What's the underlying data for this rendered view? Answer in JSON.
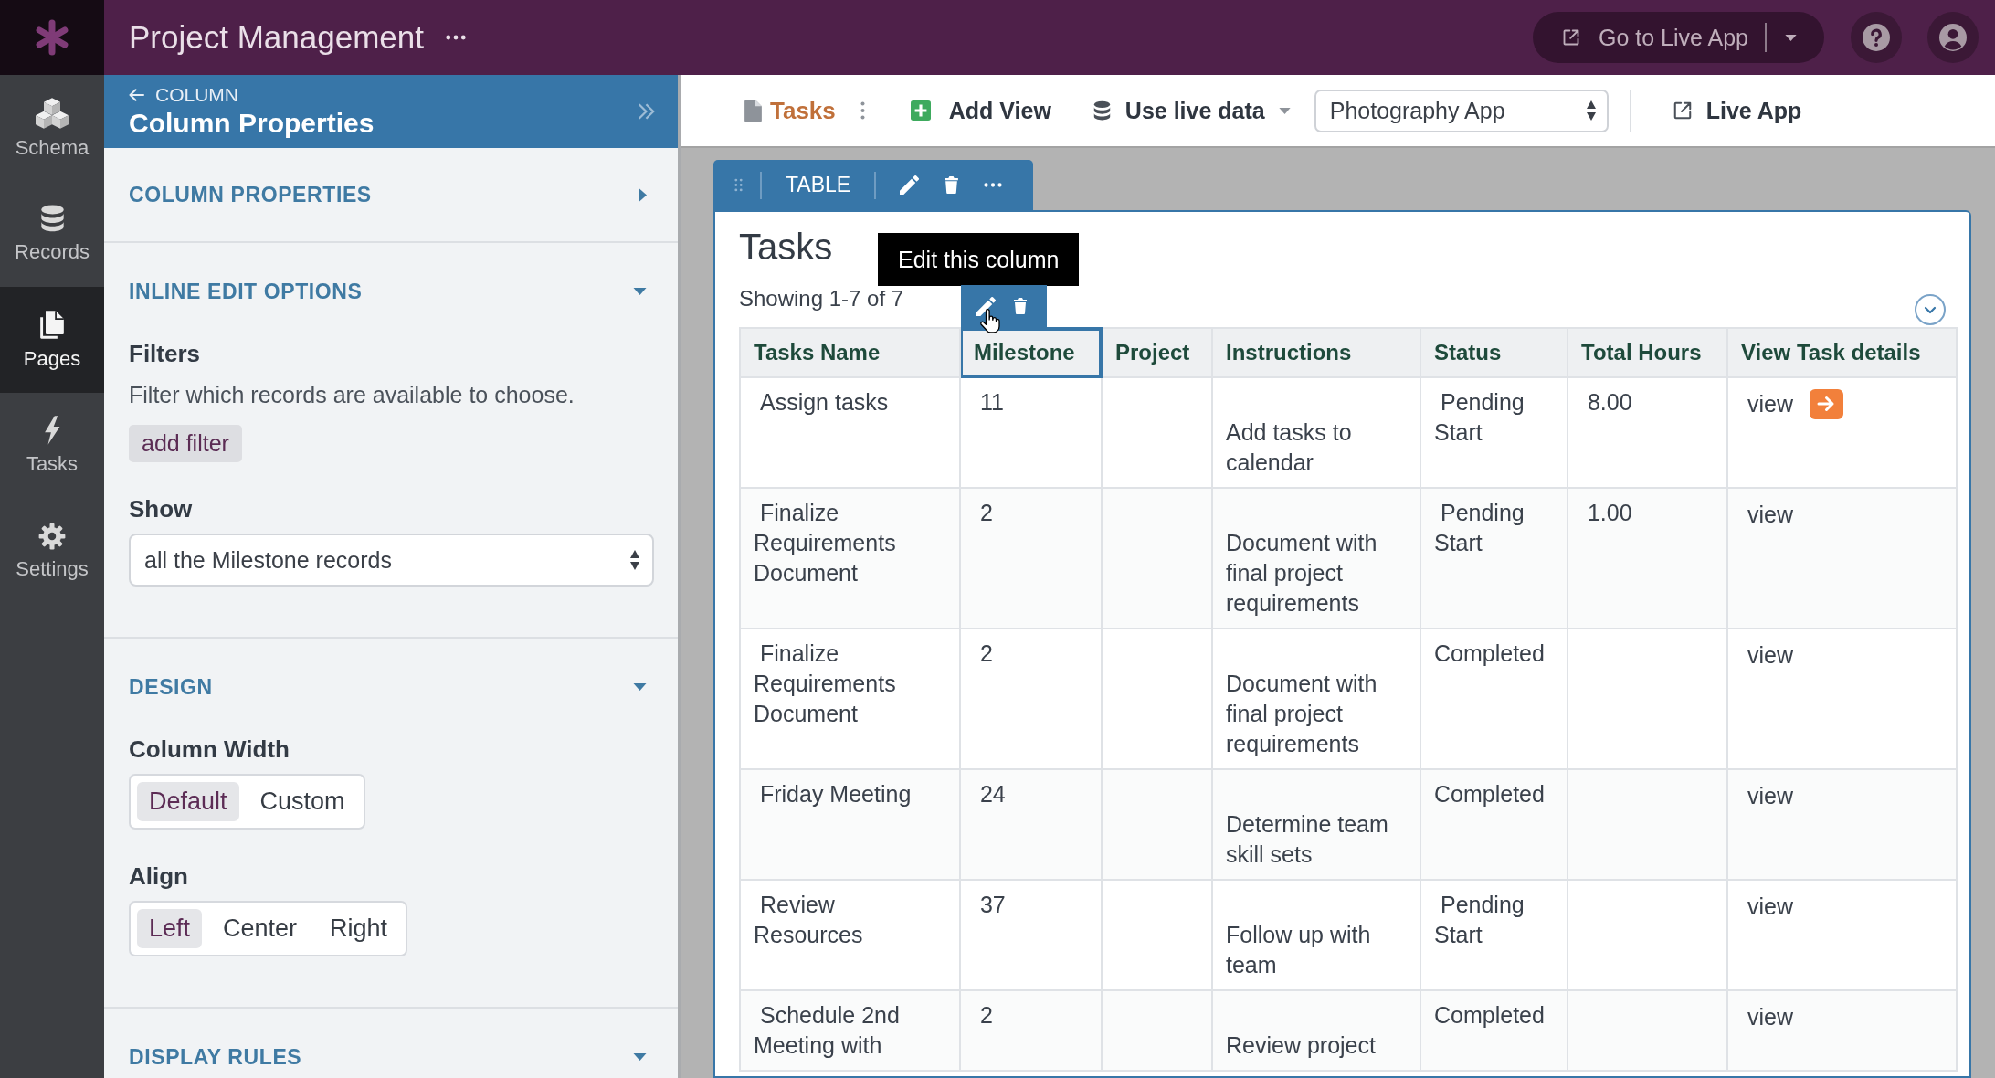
{
  "app_bar": {
    "title": "Project Management",
    "live_app_button": "Go to Live App"
  },
  "nav_rail": [
    {
      "kind": "schema",
      "label": "Schema",
      "selected": false
    },
    {
      "kind": "records",
      "label": "Records",
      "selected": false
    },
    {
      "kind": "pages",
      "label": "Pages",
      "selected": true
    },
    {
      "kind": "tasks",
      "label": "Tasks",
      "selected": false
    },
    {
      "kind": "settings",
      "label": "Settings",
      "selected": false
    }
  ],
  "panel": {
    "breadcrumb": "COLUMN",
    "title": "Column Properties",
    "sections": [
      {
        "title": "COLUMN PROPERTIES",
        "expanded": false
      },
      {
        "title": "INLINE EDIT OPTIONS",
        "expanded": true,
        "fields": [
          {
            "kind": "filter",
            "label": "Filters",
            "description": "Filter which records are available to choose.",
            "button": "add filter"
          },
          {
            "kind": "select",
            "label": "Show",
            "value": "all the Milestone records"
          }
        ]
      },
      {
        "title": "DESIGN",
        "expanded": true,
        "fields": [
          {
            "kind": "segmented",
            "label": "Column Width",
            "options": [
              {
                "label": "Default",
                "selected": true
              },
              {
                "label": "Custom",
                "selected": false
              }
            ]
          },
          {
            "kind": "segmented",
            "label": "Align",
            "options": [
              {
                "label": "Left",
                "selected": true
              },
              {
                "label": "Center",
                "selected": false
              },
              {
                "label": "Right",
                "selected": false
              }
            ]
          }
        ]
      },
      {
        "title": "DISPLAY RULES",
        "expanded": true
      }
    ]
  },
  "toolbar": {
    "page": "Tasks",
    "add_view": "Add View",
    "data_source": "Use live data",
    "app_select": "Photography App",
    "live_app": "Live App"
  },
  "view": {
    "tab": "TABLE",
    "title": "Tasks",
    "summary": "Showing 1-7 of 7",
    "tooltip": "Edit this column",
    "columns": [
      {
        "label": "Tasks Name",
        "selected": false
      },
      {
        "label": "Milestone",
        "selected": true
      },
      {
        "label": "Project",
        "selected": false
      },
      {
        "label": "Instructions",
        "selected": false
      },
      {
        "label": "Status",
        "selected": false
      },
      {
        "label": "Total Hours",
        "selected": false
      },
      {
        "label": "View Task details",
        "selected": false
      }
    ],
    "rows": [
      {
        "name": " Assign tasks",
        "milestone": " 11",
        "instructions": "Add tasks to calendar",
        "status": " Pending Start",
        "total_hours": " 8.00",
        "details": " view",
        "hovered": true
      },
      {
        "name": " Finalize Requirements Document",
        "milestone": " 2",
        "instructions": "Document with final project requirements",
        "status": " Pending Start",
        "total_hours": " 1.00",
        "details": " view",
        "hovered": false
      },
      {
        "name": " Finalize Requirements Document",
        "milestone": " 2",
        "instructions": "Document with final project requirements",
        "status": "Completed",
        "details": " view",
        "hovered": false
      },
      {
        "name": " Friday Meeting",
        "milestone": " 24",
        "instructions": "Determine team skill sets",
        "status": "Completed",
        "details": " view",
        "hovered": false
      },
      {
        "name": " Review Resources",
        "milestone": " 37",
        "instructions": "Follow up with team",
        "status": " Pending Start",
        "details": " view",
        "hovered": false
      },
      {
        "name": " Schedule 2nd Meeting with",
        "milestone": " 2",
        "instructions": "Review project",
        "status": "Completed",
        "details": " view",
        "hovered": false
      }
    ]
  }
}
